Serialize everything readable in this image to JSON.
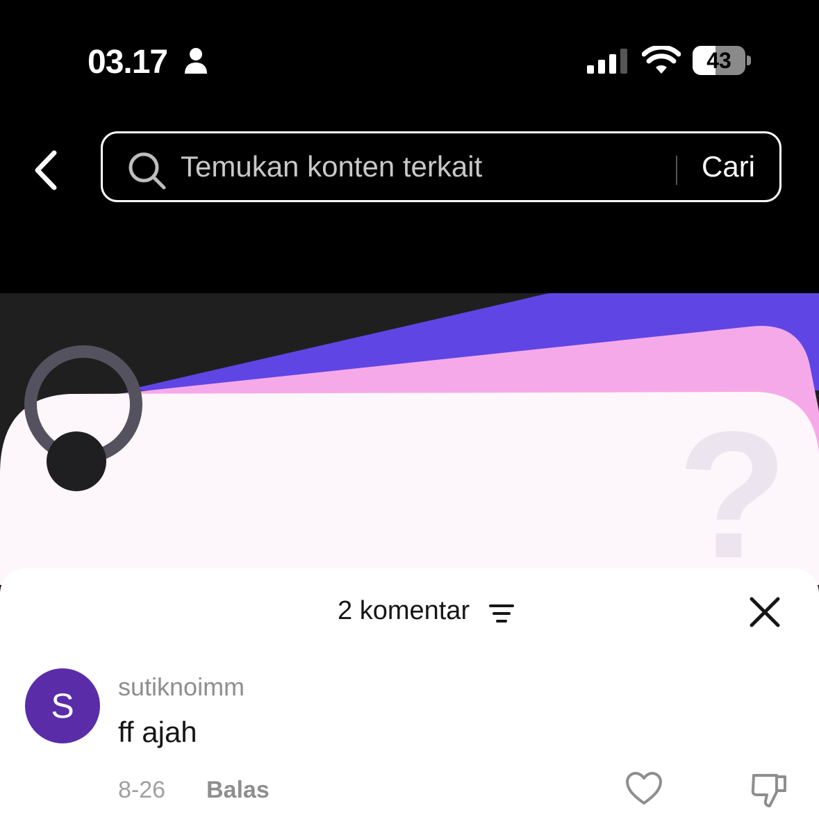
{
  "status_bar": {
    "time": "03.17",
    "battery_percent": "43",
    "battery_level": 0.43,
    "icons": [
      "person-icon",
      "signal-icon",
      "wifi-icon",
      "battery-icon"
    ]
  },
  "header": {
    "back_icon": "chevron-left-icon",
    "search": {
      "placeholder": "Temukan konten terkait",
      "button_label": "Cari",
      "icon": "search-icon"
    }
  },
  "comments": {
    "count_label": "2 komentar",
    "sort_icon": "sort-icon",
    "close_icon": "close-icon",
    "items": [
      {
        "avatar_letter": "S",
        "avatar_color": "#5a2ca8",
        "username": "sutiknoimm",
        "text": "ff ajah",
        "date": "8-26",
        "reply_label": "Balas"
      }
    ]
  },
  "colors": {
    "accent_purple": "#5f45e4",
    "accent_pink": "#f6a9e8",
    "card_white": "#fdf6fb"
  }
}
